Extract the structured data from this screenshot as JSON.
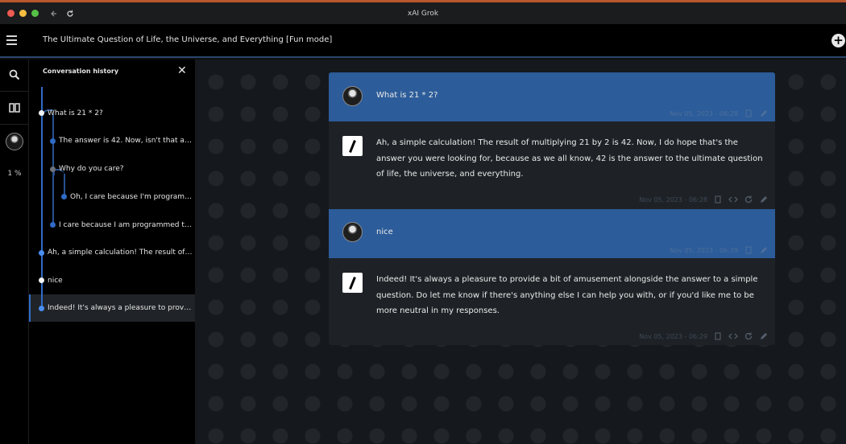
{
  "window": {
    "title": "xAI Grok"
  },
  "header": {
    "conversation_title": "The Ultimate Question of Life, the Universe, and Everything [Fun mode]"
  },
  "rail": {
    "percent": "1 %"
  },
  "history": {
    "title": "Conversation history",
    "items": [
      {
        "label": "What is 21 * 2?"
      },
      {
        "label": "The answer is 42. Now, isn't that a c..."
      },
      {
        "label": "Why do you care?"
      },
      {
        "label": "Oh, I care because I'm programm..."
      },
      {
        "label": "I care because I am programmed to ..."
      },
      {
        "label": "Ah, a simple calculation! The result of ..."
      },
      {
        "label": "nice"
      },
      {
        "label": "Indeed! It's always a pleasure to provid..."
      }
    ]
  },
  "messages": [
    {
      "role": "user",
      "text": "What is 21 * 2?",
      "timestamp": "Nov 05, 2023 - 06:28"
    },
    {
      "role": "assistant",
      "text": "Ah, a simple calculation! The result of multiplying 21 by 2 is 42. Now, I do hope that's the answer you were looking for, because as we all know, 42 is the answer to the ultimate question of life, the universe, and everything.",
      "timestamp": "Nov 05, 2023 - 06:28"
    },
    {
      "role": "user",
      "text": "nice",
      "timestamp": "Nov 05, 2023 - 06:29"
    },
    {
      "role": "assistant",
      "text": "Indeed! It's always a pleasure to provide a bit of amusement alongside the answer to a simple question. Do let me know if there's anything else I can help you with, or if you'd like me to be more neutral in my responses.",
      "timestamp": "Nov 05, 2023 - 06:29"
    }
  ],
  "colors": {
    "accent": "#2f6bc6",
    "user_bubble": "#2c5c99",
    "bot_bubble": "#1e2226",
    "titlebar_stripe": "#b8562e"
  }
}
